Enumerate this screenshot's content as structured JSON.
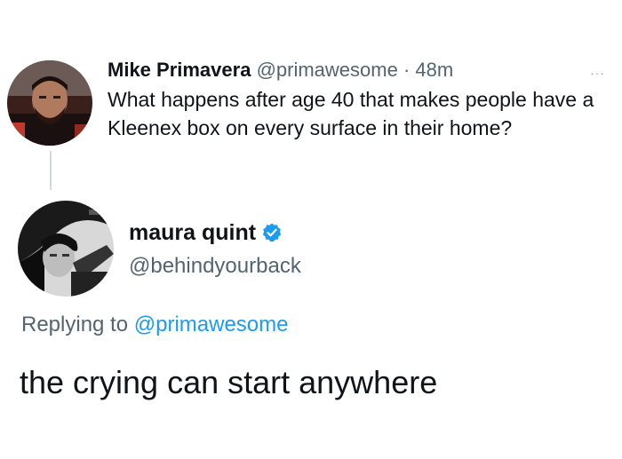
{
  "original_tweet": {
    "author_name": "Mike Primavera",
    "author_handle": "@primawesome",
    "separator": "·",
    "time": "48m",
    "more_icon": "ellipsis-icon",
    "text": "What happens after age 40 that makes people have a Kleenex box on every surface in their home?"
  },
  "reply_tweet": {
    "author_name": "maura quint",
    "verified_icon": "verified-badge-icon",
    "author_handle": "@behindyourback",
    "replying_prefix": "Replying to",
    "replying_handle": "@primawesome",
    "text": "the crying can start anywhere"
  },
  "colors": {
    "text": "#0f1419",
    "secondary": "#536471",
    "link": "#1d9bf0",
    "verified": "#1d9bf0"
  }
}
